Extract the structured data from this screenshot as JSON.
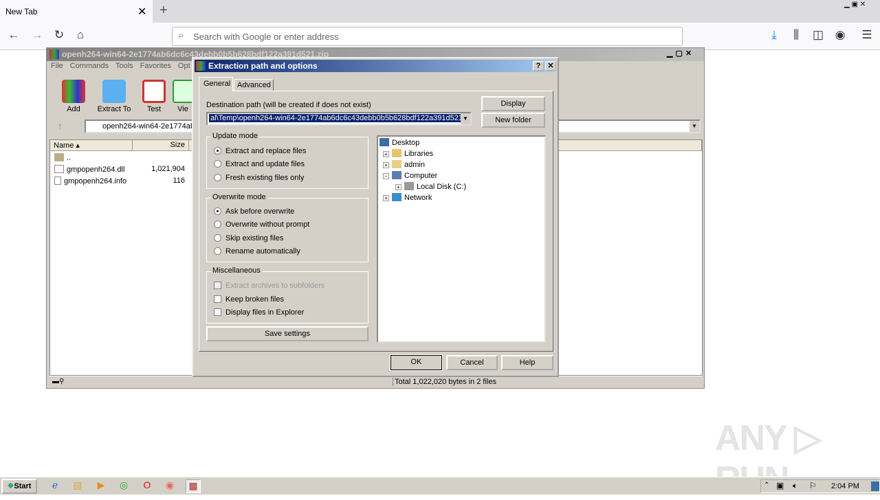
{
  "browser": {
    "tab_title": "New Tab",
    "new_tab": "+",
    "url_placeholder": "Search with Google or enter address"
  },
  "winrar": {
    "title": "openh264-win64-2e1774ab6dc6c43debb0b5b628bdf122a391d521.zip",
    "menu": [
      "File",
      "Commands",
      "Tools",
      "Favorites",
      "Opt"
    ],
    "toolbar": [
      "Add",
      "Extract To",
      "Test",
      "Vie"
    ],
    "path": "openh264-win64-2e1774ab",
    "columns": {
      "name": "Name",
      "size": "Size"
    },
    "files": [
      {
        "name": "..",
        "size": ""
      },
      {
        "name": "gmpopenh264.dll",
        "size": "1,021,904"
      },
      {
        "name": "gmpopenh264.info",
        "size": "116"
      }
    ],
    "status": "Total 1,022,020 bytes in 2 files"
  },
  "dialog": {
    "title": "Extraction path and options",
    "help": "?",
    "close": "✕",
    "tabs": [
      "General",
      "Advanced"
    ],
    "dest_label": "Destination path (will be created if does not exist)",
    "dest_value": "al\\Temp\\openh264-win64-2e1774ab6dc6c43debb0b5b628bdf122a391d521",
    "display": "Display",
    "new_folder": "New folder",
    "update_mode": {
      "label": "Update mode",
      "options": [
        "Extract and replace files",
        "Extract and update files",
        "Fresh existing files only"
      ],
      "selected": 0
    },
    "overwrite_mode": {
      "label": "Overwrite mode",
      "options": [
        "Ask before overwrite",
        "Overwrite without prompt",
        "Skip existing files",
        "Rename automatically"
      ],
      "selected": 0
    },
    "misc": {
      "label": "Miscellaneous",
      "options": [
        "Extract archives to subfolders",
        "Keep broken files",
        "Display files in Explorer"
      ]
    },
    "save": "Save settings",
    "tree": [
      "Desktop",
      "Libraries",
      "admin",
      "Computer",
      "Local Disk (C:)",
      "Network"
    ],
    "ok": "OK",
    "cancel": "Cancel",
    "help_btn": "Help"
  },
  "taskbar": {
    "start": "Start",
    "clock": "2:04 PM"
  },
  "watermark": "ANY RUN"
}
